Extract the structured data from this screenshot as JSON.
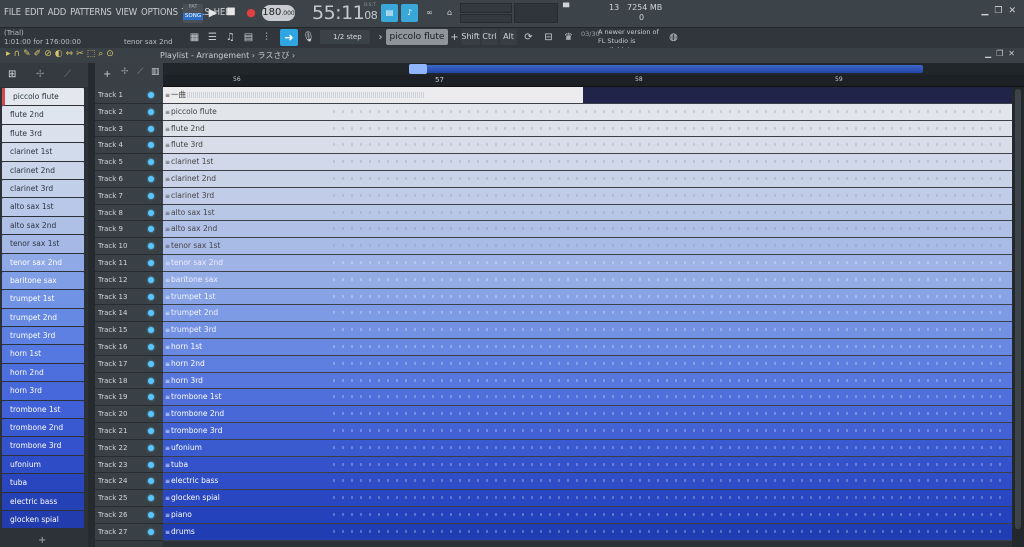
{
  "menu": [
    "FILE",
    "EDIT",
    "ADD",
    "PATTERNS",
    "VIEW",
    "OPTIONS",
    "TOOLS",
    "HELP"
  ],
  "transport": {
    "mode_top": "PAT",
    "mode_song": "SONG",
    "tempo": "180",
    "tempo_dec": ".000",
    "time_main": "55:11",
    "time_sub": "08",
    "time_label": "B:S:T"
  },
  "status": {
    "cores": "▀",
    "cpu": "13",
    "memory": "7254 MB",
    "polyphony": "0"
  },
  "hint": {
    "trial": "(Trial)",
    "position": "1:01:00 for 176:00:00",
    "instrument": "tenor sax 2nd"
  },
  "toolbar2": {
    "step": "1/2 step",
    "instrument_select": "piccolo flute",
    "shift": "Shift",
    "ctrl": "Ctrl",
    "alt": "Alt",
    "news_count": "03/30",
    "news_text": "A newer version of FL Studio is available!"
  },
  "playlist": {
    "title": "Playlist - Arrangement › ラスさび ›",
    "ruler": [
      "56",
      "57",
      "58",
      "59"
    ]
  },
  "channels": [
    {
      "label": "piccolo flute",
      "bg": "#e4e8ee"
    },
    {
      "label": "flute 2nd",
      "bg": "#dfe5ee"
    },
    {
      "label": "flute 3rd",
      "bg": "#dae1ed"
    },
    {
      "label": "clarinet 1st",
      "bg": "#d2dbeb"
    },
    {
      "label": "clarinet 2nd",
      "bg": "#cad5ea"
    },
    {
      "label": "clarinet 3rd",
      "bg": "#c2cfe9"
    },
    {
      "label": "alto sax 1st",
      "bg": "#b9c8e8"
    },
    {
      "label": "alto sax 2nd",
      "bg": "#afc0e7"
    },
    {
      "label": "tenor sax 1st",
      "bg": "#a6b9e6"
    },
    {
      "label": "tenor sax 2nd",
      "bg": "#8fa9e6"
    },
    {
      "label": "baritone sax",
      "bg": "#7f9ee6"
    },
    {
      "label": "trumpet 1st",
      "bg": "#7193e5"
    },
    {
      "label": "trumpet 2nd",
      "bg": "#6689e4"
    },
    {
      "label": "trumpet 3rd",
      "bg": "#5d80e2"
    },
    {
      "label": "horn 1st",
      "bg": "#5577e0"
    },
    {
      "label": "horn 2nd",
      "bg": "#4d6fdd"
    },
    {
      "label": "horn 3rd",
      "bg": "#4668da"
    },
    {
      "label": "trombone 1st",
      "bg": "#3f60d6"
    },
    {
      "label": "trombone 2nd",
      "bg": "#3959d1"
    },
    {
      "label": "trombone 3rd",
      "bg": "#3352cb"
    },
    {
      "label": "ufonium",
      "bg": "#2e4cc5"
    },
    {
      "label": "tuba",
      "bg": "#2946be"
    },
    {
      "label": "electric bass",
      "bg": "#2541b6"
    },
    {
      "label": "glocken spial",
      "bg": "#223cad"
    }
  ],
  "tracks": [
    {
      "name": "Track 1",
      "clip": "一曲",
      "bg": "#ececee",
      "fg": "#333"
    },
    {
      "name": "Track 2",
      "clip": "piccolo flute",
      "bg": "#e2e5ea",
      "fg": "#444"
    },
    {
      "name": "Track 3",
      "clip": "flute 2nd",
      "bg": "#dde2ea",
      "fg": "#444"
    },
    {
      "name": "Track 4",
      "clip": "flute 3rd",
      "bg": "#d8dde9",
      "fg": "#444"
    },
    {
      "name": "Track 5",
      "clip": "clarinet 1st",
      "bg": "#d0d8e9",
      "fg": "#444"
    },
    {
      "name": "Track 6",
      "clip": "clarinet 2nd",
      "bg": "#c9d3e8",
      "fg": "#444"
    },
    {
      "name": "Track 7",
      "clip": "clarinet 3rd",
      "bg": "#c1cde8",
      "fg": "#444"
    },
    {
      "name": "Track 8",
      "clip": "alto sax 1st",
      "bg": "#b9c7e7",
      "fg": "#444"
    },
    {
      "name": "Track 9",
      "clip": "alto sax 2nd",
      "bg": "#b0c0e7",
      "fg": "#444"
    },
    {
      "name": "Track 10",
      "clip": "tenor sax 1st",
      "bg": "#a8bae6",
      "fg": "#444"
    },
    {
      "name": "Track 11",
      "clip": "tenor sax 2nd",
      "bg": "#9fb3e6",
      "fg": "#eef"
    },
    {
      "name": "Track 12",
      "clip": "baritone sax",
      "bg": "#94ace6",
      "fg": "#eef"
    },
    {
      "name": "Track 13",
      "clip": "trumpet 1st",
      "bg": "#88a3e5",
      "fg": "#f2f4ff"
    },
    {
      "name": "Track 14",
      "clip": "trumpet 2nd",
      "bg": "#7d9ae4",
      "fg": "#f2f4ff"
    },
    {
      "name": "Track 15",
      "clip": "trumpet 3rd",
      "bg": "#7391e3",
      "fg": "#f2f4ff"
    },
    {
      "name": "Track 16",
      "clip": "horn 1st",
      "bg": "#6988e2",
      "fg": "#fff"
    },
    {
      "name": "Track 17",
      "clip": "horn 2nd",
      "bg": "#5f7fe0",
      "fg": "#fff"
    },
    {
      "name": "Track 18",
      "clip": "horn 3rd",
      "bg": "#5777de",
      "fg": "#fff"
    },
    {
      "name": "Track 19",
      "clip": "trombone 1st",
      "bg": "#4f6fdb",
      "fg": "#fff"
    },
    {
      "name": "Track 20",
      "clip": "trombone 2nd",
      "bg": "#4868d8",
      "fg": "#fff"
    },
    {
      "name": "Track 21",
      "clip": "trombone 3rd",
      "bg": "#4161d4",
      "fg": "#fff"
    },
    {
      "name": "Track 22",
      "clip": "ufonium",
      "bg": "#3a5ad0",
      "fg": "#fff"
    },
    {
      "name": "Track 23",
      "clip": "tuba",
      "bg": "#3453cb",
      "fg": "#fff"
    },
    {
      "name": "Track 24",
      "clip": "electric bass",
      "bg": "#2e4dc6",
      "fg": "#fff"
    },
    {
      "name": "Track 25",
      "clip": "glocken spial",
      "bg": "#2947c1",
      "fg": "#fff"
    },
    {
      "name": "Track 26",
      "clip": "piano",
      "bg": "#2442bb",
      "fg": "#fff"
    },
    {
      "name": "Track 27",
      "clip": "drums",
      "bg": "#203db4",
      "fg": "#fff"
    }
  ]
}
